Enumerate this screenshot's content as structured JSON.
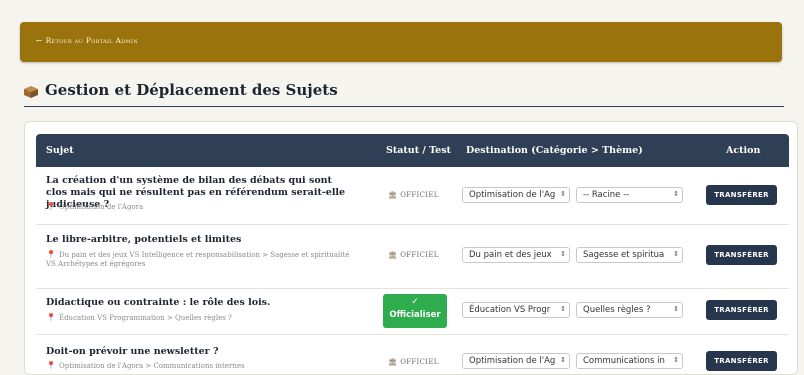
{
  "nav": {
    "back_arrow": "←",
    "back_label": "Retour au Portail Admin"
  },
  "page": {
    "title": "Gestion et Déplacement des Sujets"
  },
  "table": {
    "headers": {
      "subject": "Sujet",
      "status": "Statut / Test",
      "destination": "Destination (Catégorie > Thème)",
      "action": "Action"
    },
    "rows": [
      {
        "title": "La création d'un système de bilan des débats qui sont clos mais qui ne résultent pas en référendum serait-elle judicieuse ?",
        "path": "Optimisation de l'Agora",
        "status": "OFFICIEL",
        "category": "Optimisation de l'Ag",
        "theme": "-- Racine --",
        "action": "TRANSFÉRER"
      },
      {
        "title": "Le libre-arbitre, potentiels et limites",
        "path": "Du pain et des jeux VS Intelligence et responsabilisation > Sagesse et spiritualité VS Archétypes et égrégores",
        "status": "OFFICIEL",
        "category": "Du pain et des jeux",
        "theme": "Sagesse et spiritua",
        "action": "TRANSFÉRER"
      },
      {
        "title": "Didactique ou contrainte : le rôle des lois.",
        "path": "Éducation VS Programmation > Quelles règles ?",
        "status_button": {
          "check": "✓",
          "label": "Officialiser"
        },
        "category": "Éducation VS Progr",
        "theme": "Quelles règles ?",
        "action": "TRANSFÉRER"
      },
      {
        "title": "Doit-on prévoir une newsletter ?",
        "path": "Optimisation de l'Agora > Communications internes",
        "status": "OFFICIEL",
        "category": "Optimisation de l'Ag",
        "theme": "Communications in",
        "action": "TRANSFÉRER"
      }
    ]
  },
  "icons": {
    "pin": "📍",
    "building": "🏛",
    "select_caret": "⇕",
    "box": "package-icon"
  },
  "colors": {
    "banner": "#9a730d",
    "header": "#2f3f55",
    "button": "#26364d",
    "officialize": "#2eac4e"
  }
}
